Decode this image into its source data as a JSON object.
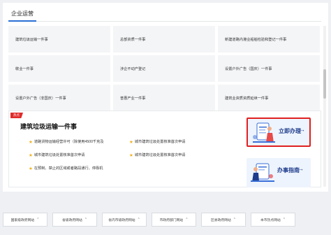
{
  "section": {
    "title": "企业运营"
  },
  "grid": {
    "rows": [
      [
        "建筑垃圾运输一件事",
        "总部资质一件事",
        "新建道路内港业船舶检验和登记一件事"
      ],
      [
        "歇业一件事",
        "涉企不动产登记",
        "设置户外广告（国庆）一件事"
      ],
      [
        "设置户外广告（非国庆）一件事",
        "普惠产业一件事",
        "建筑业资质资质延续一件事"
      ]
    ]
  },
  "feature": {
    "tag": "热点",
    "title": "建筑垃圾运输一件事",
    "items": [
      [
        "道路货物运输经营许可（除使用4500千克及",
        "城市建筑垃圾处置核准首次申请"
      ],
      [
        "城市建筑垃圾处置核准首次申请",
        "城市建筑垃圾处置核准首次申请"
      ],
      [
        "在预制、禁止的区域或者路段通行、停靠机"
      ]
    ],
    "apply_label": "立即办理",
    "guide_label": "办事指南",
    "arrow": "→"
  },
  "bottom": {
    "selects": [
      "国家级政府网站",
      "省级政府网站",
      "省内市级政府网站",
      "市政府部门网站",
      "区县政府网站",
      "本市热点网站"
    ],
    "caret": "⌃"
  },
  "colors": {
    "accent": "#2b6fd6",
    "highlight": "#e02020",
    "star": "#f1b21a",
    "tag": "#e02b2b",
    "action_text": "#1e3c8c"
  }
}
